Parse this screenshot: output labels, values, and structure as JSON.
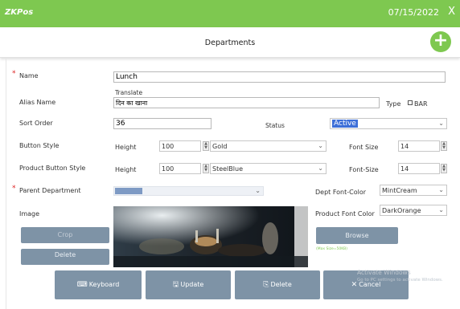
{
  "titlebar": {
    "logo_z": "ZK",
    "logo_rest": "Pos",
    "date": "07/15/2022",
    "close": "X"
  },
  "header": {
    "title": "Departments",
    "add_symbol": "+"
  },
  "form": {
    "required_mark": "*",
    "name_label": "Name",
    "name_value": "Lunch",
    "translate_label": "Translate",
    "alias_label": "Alias Name",
    "alias_value": "दिन का खाना",
    "type_label": "Type",
    "type_option": "BAR",
    "sort_label": "Sort Order",
    "sort_value": "36",
    "status_label": "Status",
    "status_value": "Active",
    "button_style_label": "Button Style",
    "height_label": "Height",
    "button_height": "100",
    "button_color": "Gold",
    "font_size_label": "Font Size",
    "button_font_size": "14",
    "product_button_style_label": "Product Button Style",
    "product_height_label": "Height",
    "product_height": "100",
    "product_color": "SteelBlue",
    "product_font_size_label": "Font-Size",
    "product_font_size": "14",
    "parent_label": "Parent Department",
    "dept_font_color_label": "Dept Font-Color",
    "dept_font_color": "MintCream",
    "image_label": "Image",
    "product_font_color_label": "Product Font Color",
    "product_font_color": "DarkOrange",
    "crop_label": "Crop",
    "delete_image_label": "Delete",
    "browse_label": "Browse",
    "max_size": "(Max Size=50KB)"
  },
  "actions": {
    "keyboard": "Keyboard",
    "update": "Update",
    "delete": "Delete",
    "cancel": "Cancel"
  },
  "watermark": {
    "line1": "Activate Windows",
    "line2": "Go to PC settings to activate Windows."
  },
  "icons": {
    "keyboard": "keyboard-icon",
    "update": "save-icon",
    "delete": "document-delete-icon",
    "cancel": "close-icon",
    "add": "plus-icon"
  },
  "colors": {
    "titlebar": "#7ec850",
    "button": "#7e93a6",
    "selection": "#3d6fd8"
  }
}
